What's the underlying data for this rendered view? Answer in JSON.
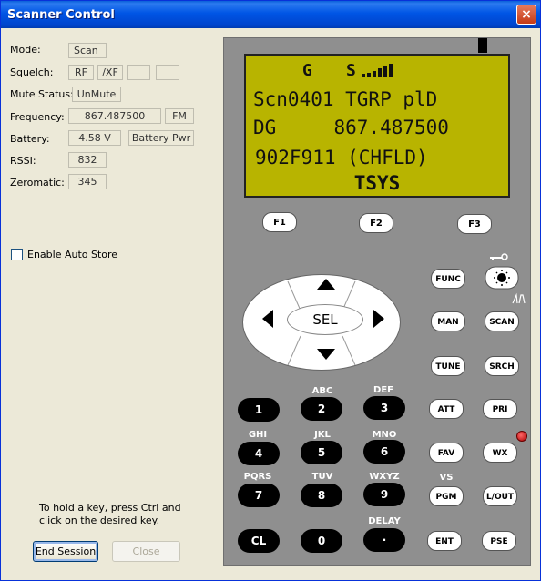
{
  "window": {
    "title": "Scanner Control",
    "close": "×"
  },
  "fields": {
    "mode": {
      "label": "Mode:",
      "value": "Scan"
    },
    "squelch": {
      "label": "Squelch:",
      "rf": "RF",
      "xf": "/XF",
      "box3": "",
      "box4": ""
    },
    "mute": {
      "label": "Mute Status:",
      "value": "UnMute"
    },
    "frequency": {
      "label": "Frequency:",
      "value": "867.487500",
      "mod": "FM"
    },
    "battery": {
      "label": "Battery:",
      "value": "4.58 V",
      "source": "Battery Pwr"
    },
    "rssi": {
      "label": "RSSI:",
      "value": "832"
    },
    "zeromatic": {
      "label": "Zeromatic:",
      "value": "345"
    }
  },
  "auto_store": {
    "label": "Enable Auto Store",
    "checked": false
  },
  "hint": "To hold a key, press Ctrl and click on the desired key.",
  "buttons": {
    "end_session": "End Session",
    "close": "Close"
  },
  "lcd": {
    "indicator_g": "G",
    "indicator_s": "S",
    "line1": "Scn0401 TGRP plD",
    "line2": "DG     867.487500",
    "line3": "902F911 (CHFLD)",
    "line4": "TSYS"
  },
  "scanner": {
    "f1": "F1",
    "f2": "F2",
    "f3": "F3",
    "sel": "SEL",
    "func": "FUNC",
    "man": "MAN",
    "scan": "SCAN",
    "tune": "TUNE",
    "srch": "SRCH",
    "att": "ATT",
    "pri": "PRI",
    "fav": "FAV",
    "wx": "WX",
    "vs": "VS",
    "pgm": "PGM",
    "lout": "L/OUT",
    "ent": "ENT",
    "pse": "PSE",
    "keys": {
      "k1": "1",
      "k2": "2",
      "k3": "3",
      "k4": "4",
      "k5": "5",
      "k6": "6",
      "k7": "7",
      "k8": "8",
      "k9": "9",
      "cl": "CL",
      "k0": "0",
      "dot": "·"
    },
    "key_labels": {
      "abc": "ABC",
      "def": "DEF",
      "ghi": "GHI",
      "jkl": "JKL",
      "mno": "MNO",
      "pqrs": "PQRS",
      "tuv": "TUV",
      "wxyz": "WXYZ",
      "delay": "DELAY"
    }
  }
}
